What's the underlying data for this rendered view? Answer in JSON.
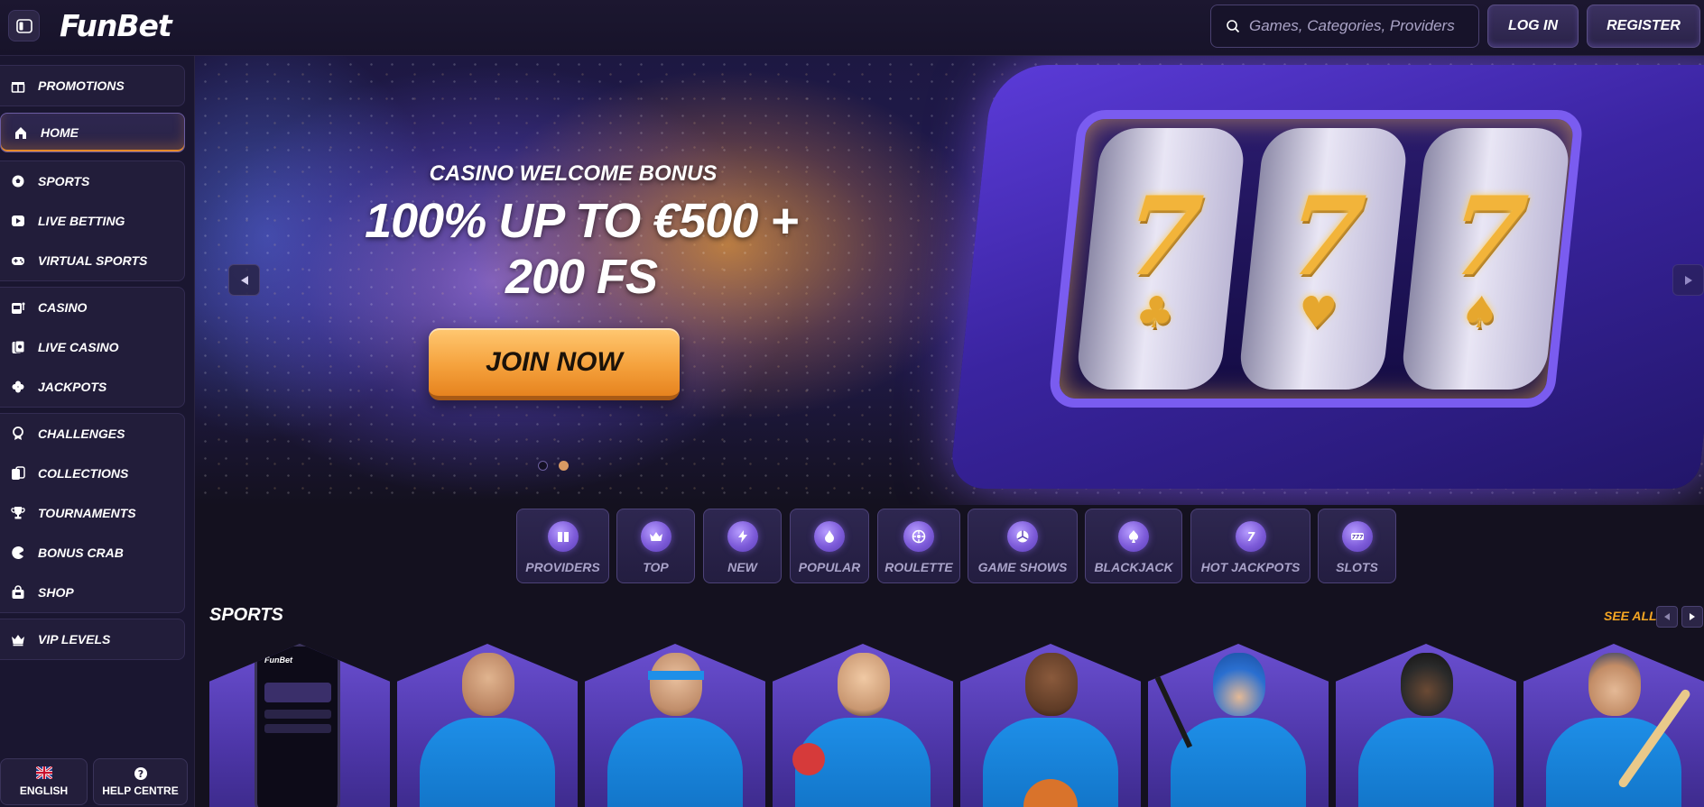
{
  "header": {
    "logo_text": "FunBet",
    "search_placeholder": "Games, Categories, Providers",
    "login_label": "LOG IN",
    "register_label": "REGISTER"
  },
  "sidebar": {
    "groups": [
      [
        {
          "label": "PROMOTIONS",
          "icon": "gift-icon"
        }
      ],
      [
        {
          "label": "HOME",
          "icon": "home-icon",
          "active": true
        }
      ],
      [
        {
          "label": "SPORTS",
          "icon": "soccer-ball-icon"
        },
        {
          "label": "LIVE BETTING",
          "icon": "play-icon"
        },
        {
          "label": "VIRTUAL SPORTS",
          "icon": "gamepad-icon"
        }
      ],
      [
        {
          "label": "CASINO",
          "icon": "slot-machine-icon"
        },
        {
          "label": "LIVE CASINO",
          "icon": "cards-icon"
        },
        {
          "label": "JACKPOTS",
          "icon": "clover-icon"
        }
      ],
      [
        {
          "label": "CHALLENGES",
          "icon": "medal-icon"
        },
        {
          "label": "COLLECTIONS",
          "icon": "collection-icon"
        },
        {
          "label": "TOURNAMENTS",
          "icon": "trophy-icon"
        },
        {
          "label": "BONUS CRAB",
          "icon": "crab-icon"
        },
        {
          "label": "SHOP",
          "icon": "shop-icon"
        }
      ],
      [
        {
          "label": "VIP LEVELS",
          "icon": "crown-icon"
        }
      ]
    ],
    "language_label": "ENGLISH",
    "help_label": "HELP CENTRE"
  },
  "hero": {
    "subtitle": "CASINO WELCOME BONUS",
    "title_line1": "100% UP TO €500 +",
    "title_line2": "200 FS",
    "cta_label": "JOIN NOW",
    "slides_total": 2,
    "slide_active": 1
  },
  "categories": [
    "PROVIDERS",
    "TOP",
    "NEW",
    "POPULAR",
    "ROULETTE",
    "GAME SHOWS",
    "BLACKJACK",
    "HOT JACKPOTS",
    "SLOTS"
  ],
  "sports_section": {
    "title": "SPORTS",
    "see_all_label": "SEE ALL",
    "phone_logo": "FunBet"
  },
  "colors": {
    "background": "#14111f",
    "accent_orange": "#f5a623",
    "accent_purple": "#7d5bd9",
    "jersey_blue": "#1e8fe8"
  }
}
